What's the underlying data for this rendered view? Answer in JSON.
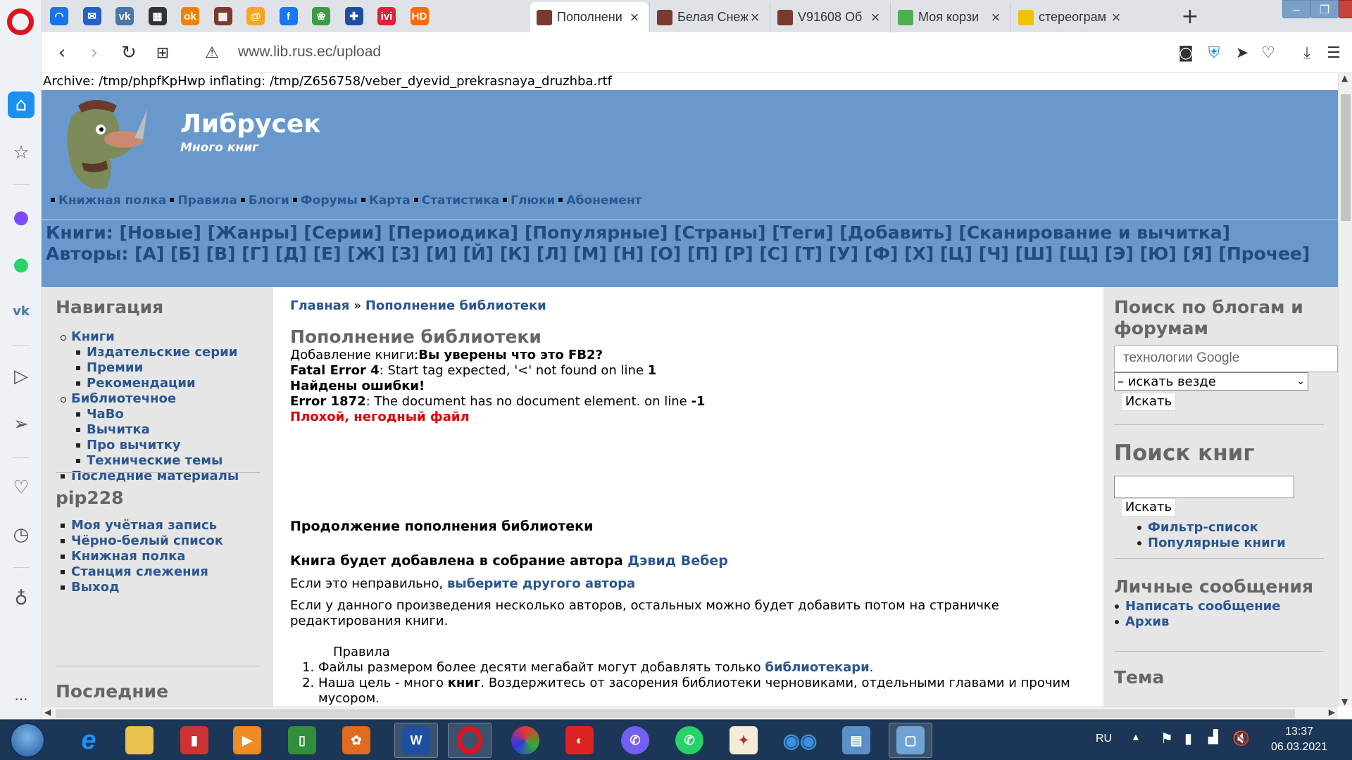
{
  "tabs": {
    "pinned": [
      {
        "name": "pinned-tab-1",
        "glyph": "◠",
        "color": "#1a73e8"
      },
      {
        "name": "pinned-tab-mail",
        "glyph": "✉",
        "color": "#2460c8"
      },
      {
        "name": "pinned-tab-vk",
        "glyph": "vk",
        "color": "#4a76a8"
      },
      {
        "name": "pinned-tab-4",
        "glyph": "▦",
        "color": "#333"
      },
      {
        "name": "pinned-tab-ok",
        "glyph": "ok",
        "color": "#ee8208"
      },
      {
        "name": "pinned-tab-6",
        "glyph": "▩",
        "color": "#7a3b2e"
      },
      {
        "name": "pinned-tab-mailru",
        "glyph": "@",
        "color": "#f5a623"
      },
      {
        "name": "pinned-tab-facebook",
        "glyph": "f",
        "color": "#1877f2"
      },
      {
        "name": "pinned-tab-9",
        "glyph": "❀",
        "color": "#3e9b45"
      },
      {
        "name": "pinned-tab-10",
        "glyph": "✚",
        "color": "#1c4fa0"
      },
      {
        "name": "pinned-tab-ivi",
        "glyph": "ivi",
        "color": "#e3213c"
      },
      {
        "name": "pinned-tab-hd",
        "glyph": "HD",
        "color": "#ff6a00"
      }
    ],
    "items": [
      {
        "title": "Пополнени",
        "active": true,
        "fav": "#7a3b2e"
      },
      {
        "title": "Белая Снеж",
        "active": false,
        "fav": "#7a3b2e"
      },
      {
        "title": "V91608 Об",
        "active": false,
        "fav": "#7a3b2e"
      },
      {
        "title": "Моя корзи",
        "active": false,
        "fav": "#4caf50"
      },
      {
        "title": "стереограм",
        "active": false,
        "fav": "#f2c200"
      }
    ]
  },
  "address": {
    "url": "www.lib.rus.ec/upload"
  },
  "statusline": "Archive: /tmp/phpfKpHwp inflating: /tmp/Z656758/veber_dyevid_prekrasnaya_druzhba.rtf",
  "site": {
    "name": "Либрусек",
    "slogan": "Много книг",
    "primary_links": [
      "Книжная полка",
      "Правила",
      "Блоги",
      "Форумы",
      "Карта",
      "Статистика",
      "Глюки",
      "Абонемент"
    ],
    "books_label": "Книги:",
    "book_links": [
      "[Новые]",
      "[Жанры]",
      "[Серии]",
      "[Периодика]",
      "[Популярные]",
      "[Страны]",
      "[Теги]",
      "[Добавить]",
      "[Сканирование и вычитка]"
    ],
    "authors_label": "Авторы:",
    "author_links": [
      "[А]",
      "[Б]",
      "[В]",
      "[Г]",
      "[Д]",
      "[Е]",
      "[Ж]",
      "[З]",
      "[И]",
      "[Й]",
      "[К]",
      "[Л]",
      "[М]",
      "[Н]",
      "[О]",
      "[П]",
      "[Р]",
      "[С]",
      "[Т]",
      "[У]",
      "[Ф]",
      "[Х]",
      "[Ц]",
      "[Ч]",
      "[Ш]",
      "[Щ]",
      "[Э]",
      "[Ю]",
      "[Я]",
      "[Прочее]"
    ]
  },
  "left": {
    "nav_title": "Навигация",
    "books": "Книги",
    "books_sub": [
      "Издательские серии",
      "Премии",
      "Рекомендации"
    ],
    "library": "Библиотечное",
    "library_sub": [
      "ЧаВо",
      "Вычитка",
      "Про вычитку",
      "Технические темы"
    ],
    "latest": "Последние материалы",
    "user_title": "pip228",
    "user_links": [
      "Моя учётная запись",
      "Чёрно-белый список",
      "Книжная полка",
      "Станция слежения",
      "Выход"
    ],
    "recent_title": "Последние"
  },
  "main": {
    "breadcrumb_home": "Главная",
    "breadcrumb_sep": "»",
    "breadcrumb_current": "Пополнение библиотеки",
    "title": "Пополнение библиотеки",
    "line1_pre": "Добавление книги:",
    "line1_bold": "Вы уверены что это FB2?",
    "err4_label": "Fatal Error 4",
    "err4_text": ": Start tag expected, '<' not found on line ",
    "err4_line": "1",
    "found_errors": "Найдены ошибки!",
    "err1872_label": "Error 1872",
    "err1872_text": ": The document has no document element. on line ",
    "err1872_line": "-1",
    "bad_file": "Плохой, негодный файл",
    "continue_title": "Продолжение пополнения библиотеки",
    "author_pre": "Книга будет добавлена в собрание автора ",
    "author_name": "Дэвид Вебер",
    "wrong_pre": "Если это неправильно, ",
    "wrong_link": "выберите другого автора",
    "several_authors": "Если у данного произведения несколько авторов, остальных можно будет добавить потом на страничке редактирования книги.",
    "rules_title": "Правила",
    "rule1_pre": "Файлы размером более десяти мегабайт могут добавлять только ",
    "rule1_link": "библиотекари",
    "rule1_post": ".",
    "rule2_pre": "Наша цель - много ",
    "rule2_bold": "книг",
    "rule2_post": ". Воздержитесь от засорения библиотеки черновиками, отдельными главами и прочим мусором."
  },
  "right": {
    "blog_search_title": "Поиск по блогам и форумам",
    "blog_search_value": "технологии Google",
    "scope_selected": "– искать везде",
    "search_btn": "Искать",
    "book_search_title": "Поиск книг",
    "book_search_btn": "Искать",
    "book_links": [
      "Фильтр-список",
      "Популярные книги"
    ],
    "pm_title": "Личные сообщения",
    "pm_links": [
      "Написать сообщение",
      "Архив"
    ],
    "theme_title": "Тема"
  },
  "taskbar": {
    "lang": "RU",
    "time": "13:37",
    "date": "06.03.2021"
  }
}
